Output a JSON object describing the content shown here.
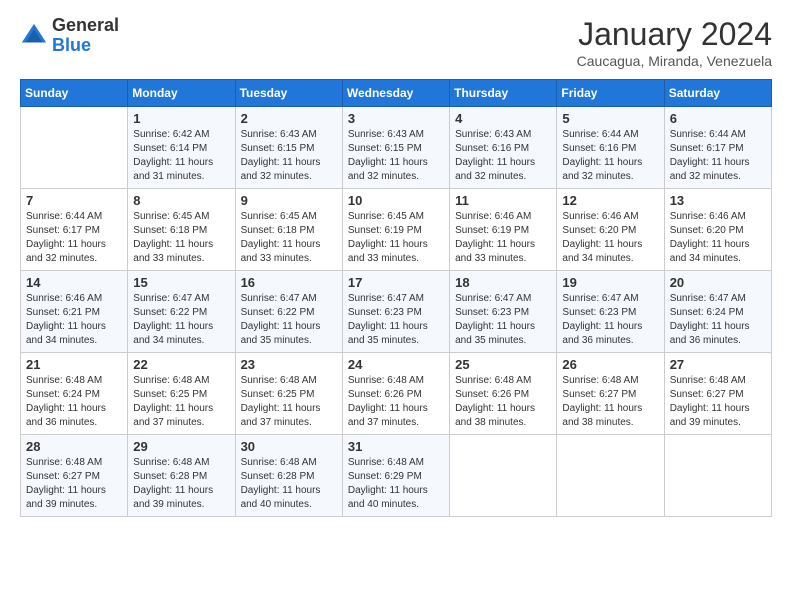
{
  "header": {
    "logo_general": "General",
    "logo_blue": "Blue",
    "month_title": "January 2024",
    "location": "Caucagua, Miranda, Venezuela"
  },
  "days_of_week": [
    "Sunday",
    "Monday",
    "Tuesday",
    "Wednesday",
    "Thursday",
    "Friday",
    "Saturday"
  ],
  "weeks": [
    [
      {
        "day": "",
        "sunrise": "",
        "sunset": "",
        "daylight": ""
      },
      {
        "day": "1",
        "sunrise": "Sunrise: 6:42 AM",
        "sunset": "Sunset: 6:14 PM",
        "daylight": "Daylight: 11 hours and 31 minutes."
      },
      {
        "day": "2",
        "sunrise": "Sunrise: 6:43 AM",
        "sunset": "Sunset: 6:15 PM",
        "daylight": "Daylight: 11 hours and 32 minutes."
      },
      {
        "day": "3",
        "sunrise": "Sunrise: 6:43 AM",
        "sunset": "Sunset: 6:15 PM",
        "daylight": "Daylight: 11 hours and 32 minutes."
      },
      {
        "day": "4",
        "sunrise": "Sunrise: 6:43 AM",
        "sunset": "Sunset: 6:16 PM",
        "daylight": "Daylight: 11 hours and 32 minutes."
      },
      {
        "day": "5",
        "sunrise": "Sunrise: 6:44 AM",
        "sunset": "Sunset: 6:16 PM",
        "daylight": "Daylight: 11 hours and 32 minutes."
      },
      {
        "day": "6",
        "sunrise": "Sunrise: 6:44 AM",
        "sunset": "Sunset: 6:17 PM",
        "daylight": "Daylight: 11 hours and 32 minutes."
      }
    ],
    [
      {
        "day": "7",
        "sunrise": "Sunrise: 6:44 AM",
        "sunset": "Sunset: 6:17 PM",
        "daylight": "Daylight: 11 hours and 32 minutes."
      },
      {
        "day": "8",
        "sunrise": "Sunrise: 6:45 AM",
        "sunset": "Sunset: 6:18 PM",
        "daylight": "Daylight: 11 hours and 33 minutes."
      },
      {
        "day": "9",
        "sunrise": "Sunrise: 6:45 AM",
        "sunset": "Sunset: 6:18 PM",
        "daylight": "Daylight: 11 hours and 33 minutes."
      },
      {
        "day": "10",
        "sunrise": "Sunrise: 6:45 AM",
        "sunset": "Sunset: 6:19 PM",
        "daylight": "Daylight: 11 hours and 33 minutes."
      },
      {
        "day": "11",
        "sunrise": "Sunrise: 6:46 AM",
        "sunset": "Sunset: 6:19 PM",
        "daylight": "Daylight: 11 hours and 33 minutes."
      },
      {
        "day": "12",
        "sunrise": "Sunrise: 6:46 AM",
        "sunset": "Sunset: 6:20 PM",
        "daylight": "Daylight: 11 hours and 34 minutes."
      },
      {
        "day": "13",
        "sunrise": "Sunrise: 6:46 AM",
        "sunset": "Sunset: 6:20 PM",
        "daylight": "Daylight: 11 hours and 34 minutes."
      }
    ],
    [
      {
        "day": "14",
        "sunrise": "Sunrise: 6:46 AM",
        "sunset": "Sunset: 6:21 PM",
        "daylight": "Daylight: 11 hours and 34 minutes."
      },
      {
        "day": "15",
        "sunrise": "Sunrise: 6:47 AM",
        "sunset": "Sunset: 6:22 PM",
        "daylight": "Daylight: 11 hours and 34 minutes."
      },
      {
        "day": "16",
        "sunrise": "Sunrise: 6:47 AM",
        "sunset": "Sunset: 6:22 PM",
        "daylight": "Daylight: 11 hours and 35 minutes."
      },
      {
        "day": "17",
        "sunrise": "Sunrise: 6:47 AM",
        "sunset": "Sunset: 6:23 PM",
        "daylight": "Daylight: 11 hours and 35 minutes."
      },
      {
        "day": "18",
        "sunrise": "Sunrise: 6:47 AM",
        "sunset": "Sunset: 6:23 PM",
        "daylight": "Daylight: 11 hours and 35 minutes."
      },
      {
        "day": "19",
        "sunrise": "Sunrise: 6:47 AM",
        "sunset": "Sunset: 6:23 PM",
        "daylight": "Daylight: 11 hours and 36 minutes."
      },
      {
        "day": "20",
        "sunrise": "Sunrise: 6:47 AM",
        "sunset": "Sunset: 6:24 PM",
        "daylight": "Daylight: 11 hours and 36 minutes."
      }
    ],
    [
      {
        "day": "21",
        "sunrise": "Sunrise: 6:48 AM",
        "sunset": "Sunset: 6:24 PM",
        "daylight": "Daylight: 11 hours and 36 minutes."
      },
      {
        "day": "22",
        "sunrise": "Sunrise: 6:48 AM",
        "sunset": "Sunset: 6:25 PM",
        "daylight": "Daylight: 11 hours and 37 minutes."
      },
      {
        "day": "23",
        "sunrise": "Sunrise: 6:48 AM",
        "sunset": "Sunset: 6:25 PM",
        "daylight": "Daylight: 11 hours and 37 minutes."
      },
      {
        "day": "24",
        "sunrise": "Sunrise: 6:48 AM",
        "sunset": "Sunset: 6:26 PM",
        "daylight": "Daylight: 11 hours and 37 minutes."
      },
      {
        "day": "25",
        "sunrise": "Sunrise: 6:48 AM",
        "sunset": "Sunset: 6:26 PM",
        "daylight": "Daylight: 11 hours and 38 minutes."
      },
      {
        "day": "26",
        "sunrise": "Sunrise: 6:48 AM",
        "sunset": "Sunset: 6:27 PM",
        "daylight": "Daylight: 11 hours and 38 minutes."
      },
      {
        "day": "27",
        "sunrise": "Sunrise: 6:48 AM",
        "sunset": "Sunset: 6:27 PM",
        "daylight": "Daylight: 11 hours and 39 minutes."
      }
    ],
    [
      {
        "day": "28",
        "sunrise": "Sunrise: 6:48 AM",
        "sunset": "Sunset: 6:27 PM",
        "daylight": "Daylight: 11 hours and 39 minutes."
      },
      {
        "day": "29",
        "sunrise": "Sunrise: 6:48 AM",
        "sunset": "Sunset: 6:28 PM",
        "daylight": "Daylight: 11 hours and 39 minutes."
      },
      {
        "day": "30",
        "sunrise": "Sunrise: 6:48 AM",
        "sunset": "Sunset: 6:28 PM",
        "daylight": "Daylight: 11 hours and 40 minutes."
      },
      {
        "day": "31",
        "sunrise": "Sunrise: 6:48 AM",
        "sunset": "Sunset: 6:29 PM",
        "daylight": "Daylight: 11 hours and 40 minutes."
      },
      {
        "day": "",
        "sunrise": "",
        "sunset": "",
        "daylight": ""
      },
      {
        "day": "",
        "sunrise": "",
        "sunset": "",
        "daylight": ""
      },
      {
        "day": "",
        "sunrise": "",
        "sunset": "",
        "daylight": ""
      }
    ]
  ]
}
